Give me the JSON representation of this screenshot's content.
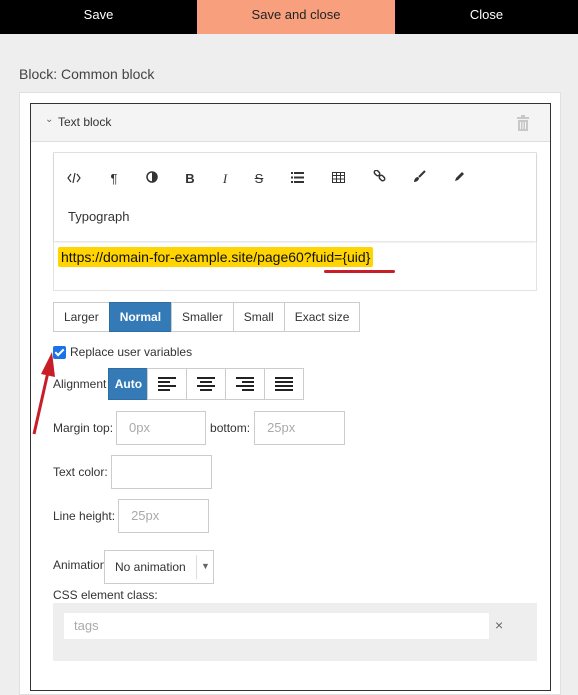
{
  "topbar": {
    "save": "Save",
    "save_close": "Save and close",
    "close": "Close"
  },
  "block_title": "Block: Common block",
  "block": {
    "title": "Text block"
  },
  "editor": {
    "toolbar_icons": [
      "code-icon",
      "paragraph-icon",
      "contrast-icon",
      "bold-icon",
      "italic-icon",
      "strikethrough-icon",
      "list-icon",
      "table-icon",
      "link-icon",
      "brush-icon",
      "pencil-icon"
    ],
    "typograph": "Typograph",
    "content": "https://domain-for-example.site/page60?fuid={uid}"
  },
  "size_options": [
    "Larger",
    "Normal",
    "Smaller",
    "Small",
    "Exact size"
  ],
  "size_selected": "Normal",
  "replace_vars": {
    "label": "Replace user variables",
    "checked": true
  },
  "alignment": {
    "label": "Alignment",
    "auto": "Auto",
    "selected": "Auto"
  },
  "margin": {
    "top_label": "Margin top:",
    "top_placeholder": "0px",
    "bottom_label": "bottom:",
    "bottom_placeholder": "25px"
  },
  "text_color": {
    "label": "Text color:",
    "value": ""
  },
  "line_height": {
    "label": "Line height:",
    "placeholder": "25px"
  },
  "animation": {
    "label": "Animation:",
    "value": "No animation"
  },
  "css_class": {
    "label": "CSS element class:",
    "placeholder": "tags",
    "clear": "×"
  },
  "colors": {
    "accent": "#337ab7",
    "save_close_bg": "#f8a07e",
    "highlight": "#ffd400",
    "annotation": "#c81e28"
  }
}
